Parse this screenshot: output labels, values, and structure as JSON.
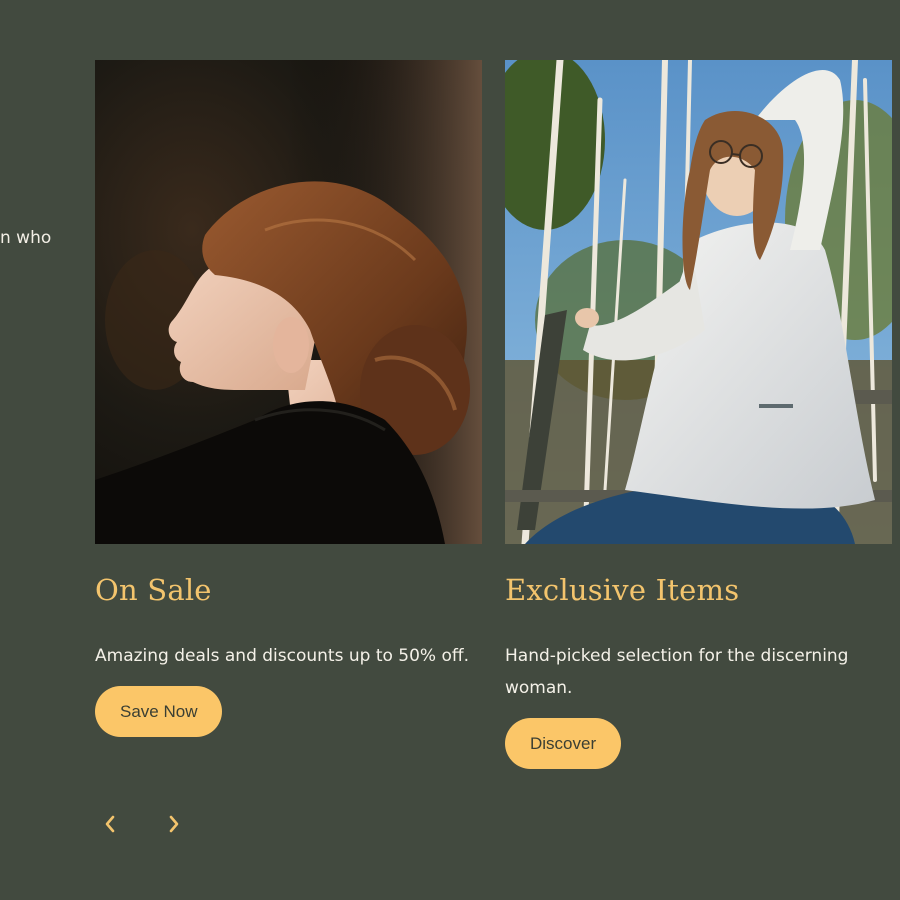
{
  "intro": {
    "partial_text": "n who"
  },
  "slides": [
    {
      "title": "On Sale",
      "description": "Amazing deals and discounts up to 50% off.",
      "button_label": "Save Now",
      "image_subject": "woman with auburn hair in a low bun, side profile, dark coat"
    },
    {
      "title": "Exclusive Items",
      "description": "Hand-picked selection for the discerning woman.",
      "button_label": "Discover",
      "image_subject": "woman in white sweater and glasses sitting on a fence among birch trees"
    }
  ],
  "carousel": {
    "prev_icon": "chevron-left-icon",
    "next_icon": "chevron-right-icon"
  },
  "colors": {
    "background": "#424a3f",
    "accent": "#f3c46d",
    "button": "#fbc668",
    "button_text": "#3b3f33",
    "text": "#f4f1e8"
  }
}
